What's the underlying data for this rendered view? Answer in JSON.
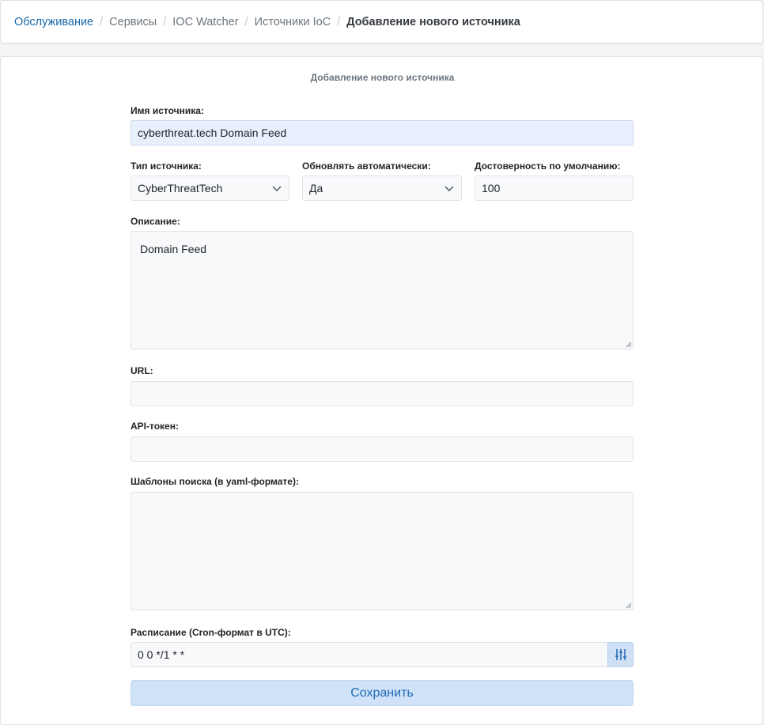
{
  "breadcrumb": {
    "items": [
      "Обслуживание",
      "Сервисы",
      "IOC Watcher",
      "Источники IoC"
    ],
    "current": "Добавление нового источника"
  },
  "form": {
    "title": "Добавление нового источника",
    "source_name": {
      "label": "Имя источника:",
      "value": "cyberthreat.tech Domain Feed"
    },
    "source_type": {
      "label": "Тип источника:",
      "value": "CyberThreatTech"
    },
    "auto_update": {
      "label": "Обновлять автоматически:",
      "value": "Да"
    },
    "confidence": {
      "label": "Достоверность по умолчанию:",
      "value": "100"
    },
    "description": {
      "label": "Описание:",
      "value": "Domain Feed"
    },
    "url": {
      "label": "URL:",
      "value": ""
    },
    "api_token": {
      "label": "API-токен:",
      "value": ""
    },
    "search_patterns": {
      "label": "Шаблоны поиска (в yaml-формате):",
      "value": ""
    },
    "schedule": {
      "label": "Расписание (Cron-формат в UTC):",
      "value": "0 0 */1 * *"
    },
    "save_label": "Сохранить"
  }
}
